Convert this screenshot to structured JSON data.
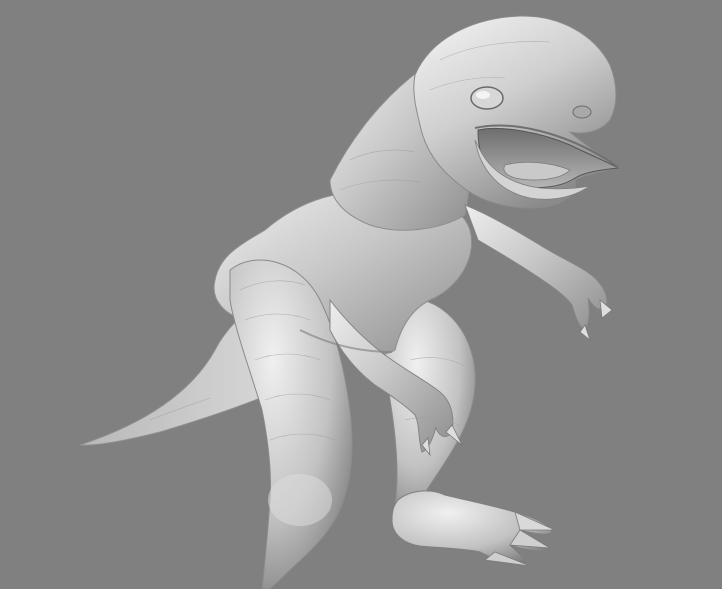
{
  "scene": {
    "background_color": "#808080",
    "model": {
      "subject": "dinosaur",
      "render_style": "gray clay shaded sculpt",
      "base_color": "#c4c4c4",
      "highlight_color": "#f2f2f2",
      "shadow_color": "#5f5f5f"
    }
  }
}
